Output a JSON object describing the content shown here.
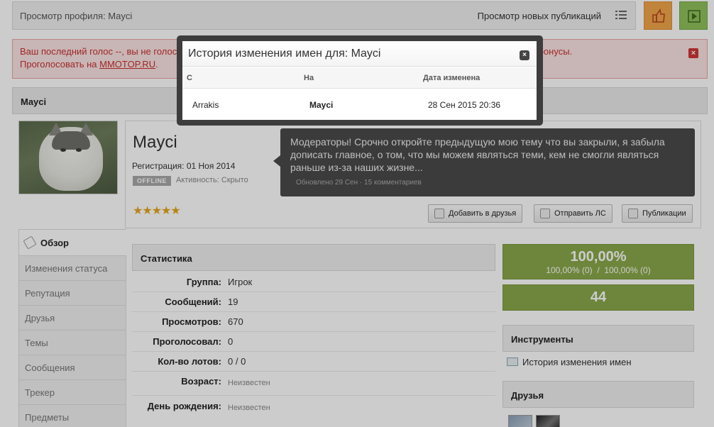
{
  "topbar": {
    "breadcrumb": "Просмотр профиля: Mayci",
    "new_posts": "Просмотр новых публикаций"
  },
  "alert": {
    "line1": "Ваш последний голос --, вы не голосовали уже долгое время. Проголосуйте за развитие нашего проекта, а вы получите бонусы.",
    "line2_prefix": "Проголосовать на ",
    "link": "MMOTOP.RU",
    "line2_suffix": ".",
    "close": "×"
  },
  "profile": {
    "header_name": "Mayci",
    "name": "Mayci",
    "registration": "Регистрация: 01 Ноя 2014",
    "online_status": "OFFLINE",
    "activity": "Активность: Скрыто",
    "rating_stars": 5,
    "status_text": "Модераторы! Срочно откройте предыдущую мою тему что вы закрыли, я забыла дописать главное, о том, что мы можем являться теми, кем не смогли являться раньше из-за наших жизне...",
    "status_meta": "Обновлено 29 Сен · 15 комментариев",
    "buttons": {
      "add_friend": "Добавить в друзья",
      "send_pm": "Отправить ЛС",
      "publications": "Публикации"
    }
  },
  "nav": {
    "overview": "Обзор",
    "items": [
      "Изменения статуса",
      "Репутация",
      "Друзья",
      "Темы",
      "Сообщения",
      "Трекер",
      "Предметы"
    ]
  },
  "stats": {
    "title": "Статистика",
    "rows": [
      {
        "k": "Группа:",
        "v": "Игрок"
      },
      {
        "k": "Сообщений:",
        "v": "19"
      },
      {
        "k": "Просмотров:",
        "v": "670"
      },
      {
        "k": "Проголосовал:",
        "v": "0"
      },
      {
        "k": "Кол-во лотов:",
        "v": "0 / 0"
      },
      {
        "k": "Возраст:",
        "v": "Неизвестен"
      },
      {
        "k": "День рождения:",
        "v": "Неизвестен"
      }
    ]
  },
  "right": {
    "reputation_percent": "100,00%",
    "reputation_detail": "100,00% (0)  /  100,00% (0)",
    "count": "44",
    "tools_title": "Инструменты",
    "tool_item": "История изменения имен",
    "friends_title": "Друзья"
  },
  "modal": {
    "title": "История изменения имен для: Mayci",
    "close": "×",
    "col_from": "С",
    "col_to": "На",
    "col_date": "Дата изменена",
    "row": {
      "from": "Arrakis",
      "to": "Mayci",
      "date": "28 Сен 2015 20:36"
    }
  },
  "colors": {
    "accent_green": "#8aa84a",
    "alert_red": "#c83030",
    "orange_button": "#f2a54a",
    "green_button": "#8fc15a"
  }
}
